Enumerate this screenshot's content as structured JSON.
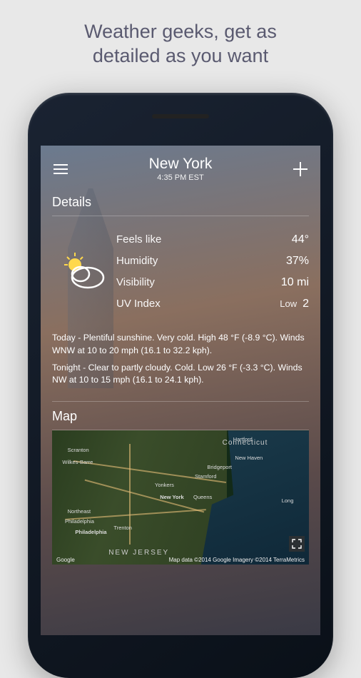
{
  "promo": {
    "line1": "Weather geeks, get as",
    "line2": "detailed as you want"
  },
  "header": {
    "city": "New York",
    "time": "4:35 PM EST"
  },
  "details": {
    "section_title": "Details",
    "rows": [
      {
        "label": "Feels like",
        "value": "44°"
      },
      {
        "label": "Humidity",
        "value": "37%"
      },
      {
        "label": "Visibility",
        "value": "10 mi"
      },
      {
        "label": "UV Index",
        "value_prefix": "Low",
        "value": "2"
      }
    ]
  },
  "forecast": {
    "today": "Today - Plentiful sunshine. Very cold. High 48 °F (-8.9 °C). Winds WNW at 10 to 20 mph (16.1 to 32.2 kph).",
    "tonight": "Tonight - Clear to partly cloudy. Cold. Low 26 °F (-3.3 °C). Winds NW at 10 to 15 mph (16.1 to 24.1 kph)."
  },
  "map": {
    "section_title": "Map",
    "provider": "Google",
    "attribution": "Map data ©2014 Google  Imagery ©2014 TerraMetrics",
    "states": [
      "Connecticut",
      "NEW JERSEY"
    ],
    "cities": [
      "Scranton",
      "Wilkes-Barre",
      "Hartford",
      "New Haven",
      "Bridgeport",
      "Stamford",
      "Yonkers",
      "New York",
      "Queens",
      "Long",
      "Northeast",
      "Philadelphia",
      "Philadelphia",
      "Trenton"
    ]
  }
}
